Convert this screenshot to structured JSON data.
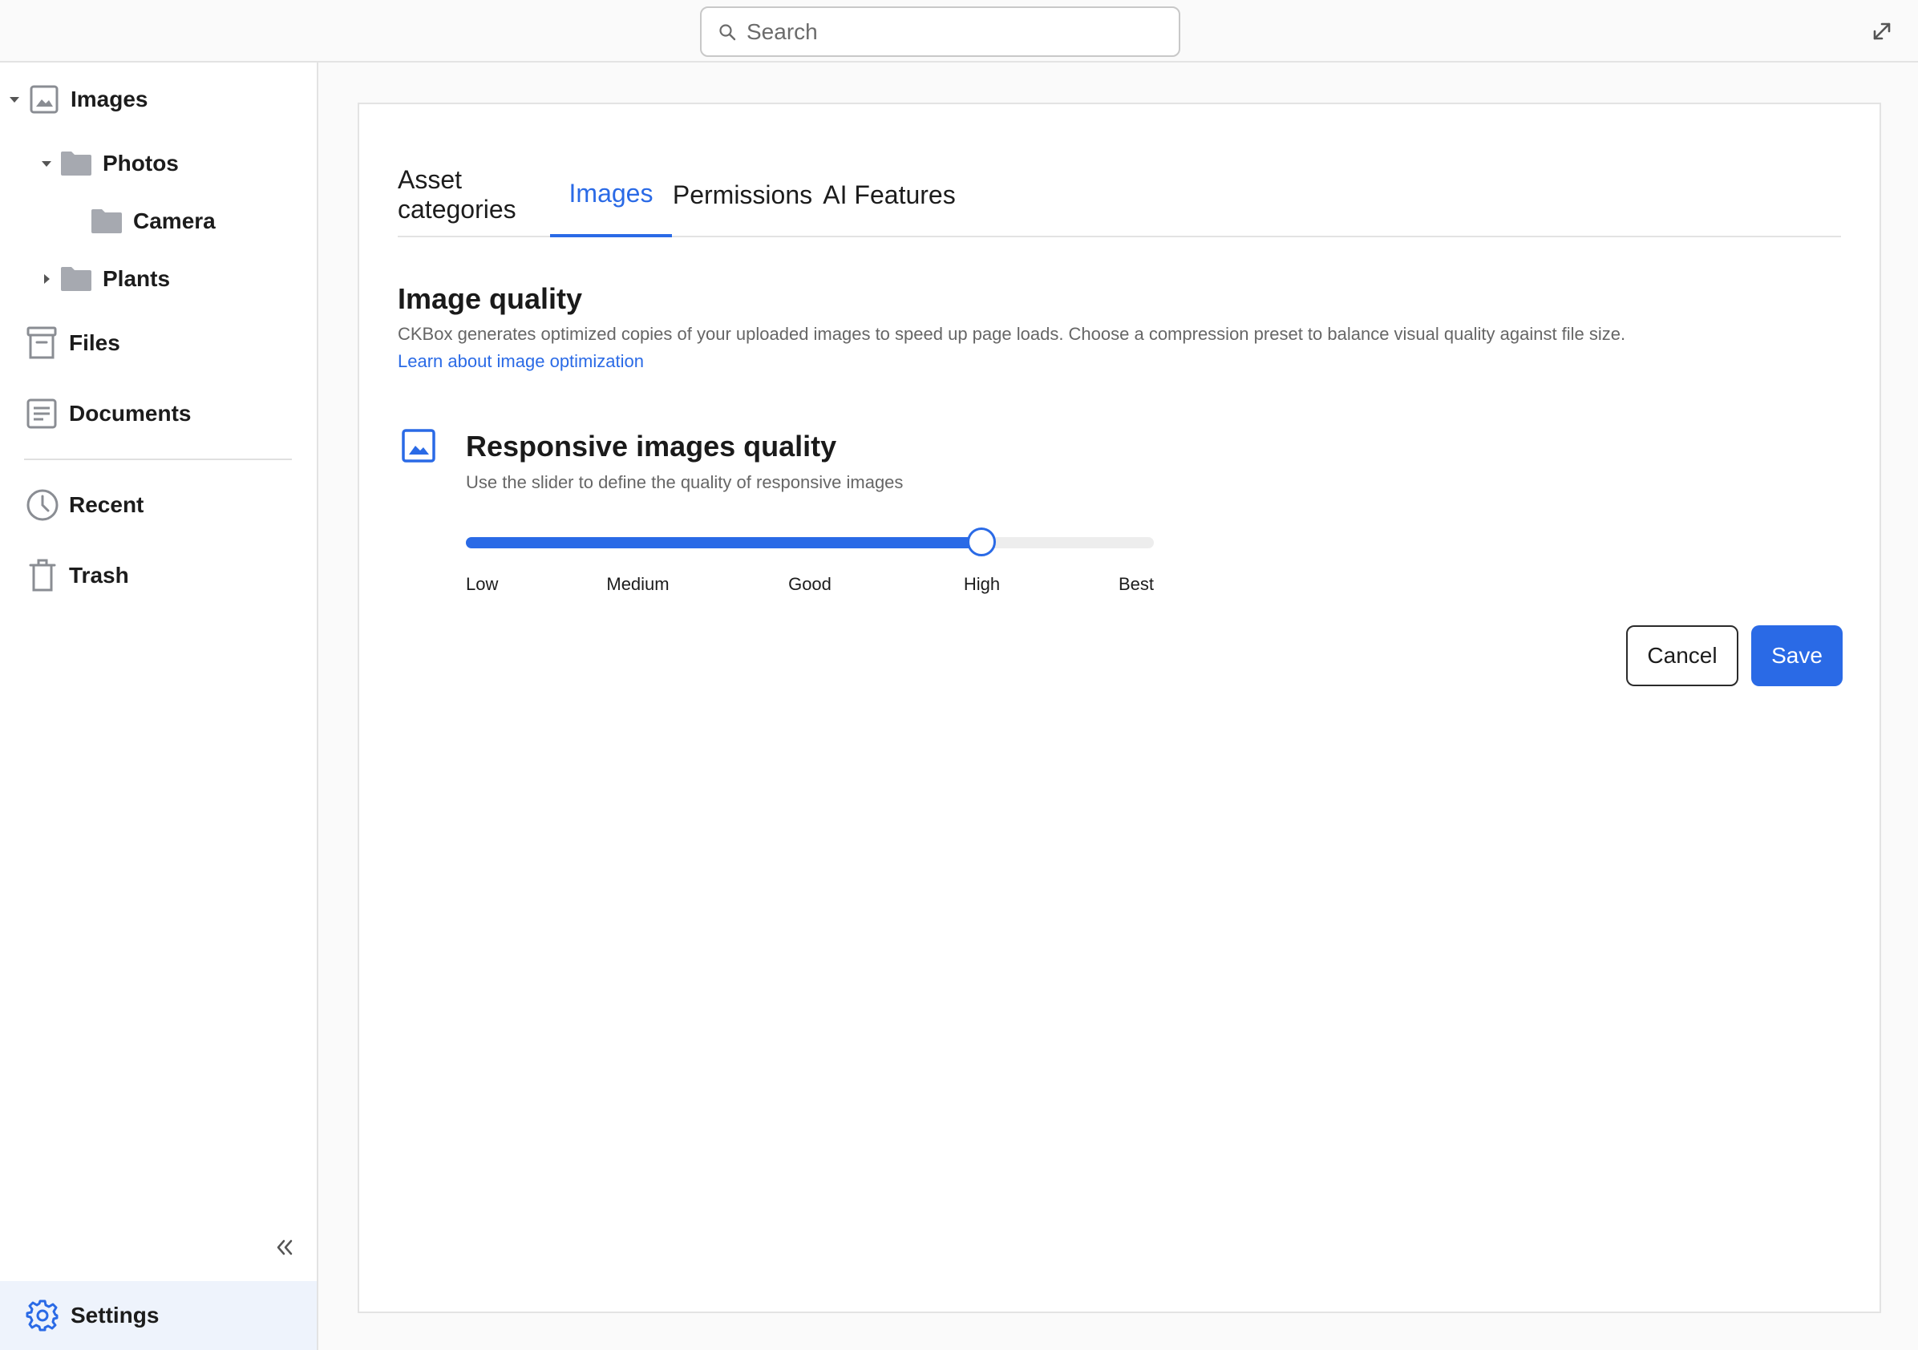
{
  "search": {
    "placeholder": "Search"
  },
  "sidebar": {
    "items": [
      {
        "label": "Images",
        "icon": "image-icon",
        "expanded": true
      },
      {
        "label": "Photos",
        "icon": "folder-icon",
        "expanded": true
      },
      {
        "label": "Camera",
        "icon": "folder-icon"
      },
      {
        "label": "Plants",
        "icon": "folder-icon",
        "expanded": false
      },
      {
        "label": "Files",
        "icon": "archive-icon"
      },
      {
        "label": "Documents",
        "icon": "document-icon"
      },
      {
        "label": "Recent",
        "icon": "clock-icon"
      },
      {
        "label": "Trash",
        "icon": "trash-icon"
      }
    ],
    "settings_label": "Settings"
  },
  "tabs": [
    {
      "label": "Asset categories",
      "active": false
    },
    {
      "label": "Images",
      "active": true
    },
    {
      "label": "Permissions",
      "active": false
    },
    {
      "label": "AI Features",
      "active": false
    }
  ],
  "image_quality": {
    "title": "Image quality",
    "description": "CKBox generates optimized copies of your uploaded images to speed up page loads. Choose a compression preset to balance visual quality against file size.",
    "link": "Learn about image optimization"
  },
  "responsive": {
    "title": "Responsive images quality",
    "description": "Use the slider to define the quality of responsive images",
    "levels": [
      "Low",
      "Medium",
      "Good",
      "High",
      "Best"
    ],
    "selected_level": "High",
    "value_fraction": 0.75
  },
  "actions": {
    "cancel": "Cancel",
    "save": "Save"
  },
  "colors": {
    "accent": "#2a6ae6",
    "settings_bg": "#eef3fc",
    "folder_gray": "#a6a9b0"
  }
}
